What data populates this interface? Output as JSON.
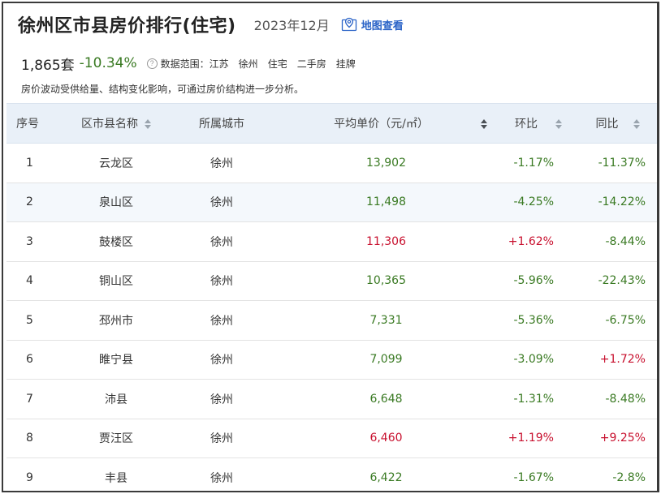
{
  "header": {
    "title": "徐州区市县房价排行(住宅)",
    "date": "2023年12月",
    "map_link": "地图查看"
  },
  "stats": {
    "count": "1,865套",
    "change": "-10.34%",
    "help_icon": "?",
    "scope_label": "数据范围：",
    "scope_tags": [
      "江苏",
      "徐州",
      "住宅",
      "二手房",
      "挂牌"
    ]
  },
  "note": "房价波动受供给量、结构变化影响，可通过房价结构进一步分析。",
  "colors": {
    "up": "#c8102e",
    "down": "#3a7a23",
    "link": "#2a63c7",
    "header_bg": "#e9f0f8"
  },
  "table": {
    "columns": [
      "序号",
      "区市县名称",
      "所属城市",
      "平均单价（元/㎡）",
      "环比",
      "同比"
    ],
    "rows": [
      {
        "idx": "1",
        "name": "云龙区",
        "city": "徐州",
        "price": "13,902",
        "mom": "-1.17%",
        "yoy": "-11.37%"
      },
      {
        "idx": "2",
        "name": "泉山区",
        "city": "徐州",
        "price": "11,498",
        "mom": "-4.25%",
        "yoy": "-14.22%"
      },
      {
        "idx": "3",
        "name": "鼓楼区",
        "city": "徐州",
        "price": "11,306",
        "mom": "+1.62%",
        "yoy": "-8.44%"
      },
      {
        "idx": "4",
        "name": "铜山区",
        "city": "徐州",
        "price": "10,365",
        "mom": "-5.96%",
        "yoy": "-22.43%"
      },
      {
        "idx": "5",
        "name": "邳州市",
        "city": "徐州",
        "price": "7,331",
        "mom": "-5.36%",
        "yoy": "-6.75%"
      },
      {
        "idx": "6",
        "name": "睢宁县",
        "city": "徐州",
        "price": "7,099",
        "mom": "-3.09%",
        "yoy": "+1.72%"
      },
      {
        "idx": "7",
        "name": "沛县",
        "city": "徐州",
        "price": "6,648",
        "mom": "-1.31%",
        "yoy": "-8.48%"
      },
      {
        "idx": "8",
        "name": "贾汪区",
        "city": "徐州",
        "price": "6,460",
        "mom": "+1.19%",
        "yoy": "+9.25%"
      },
      {
        "idx": "9",
        "name": "丰县",
        "city": "徐州",
        "price": "6,422",
        "mom": "-1.67%",
        "yoy": "-2.8%"
      }
    ]
  }
}
